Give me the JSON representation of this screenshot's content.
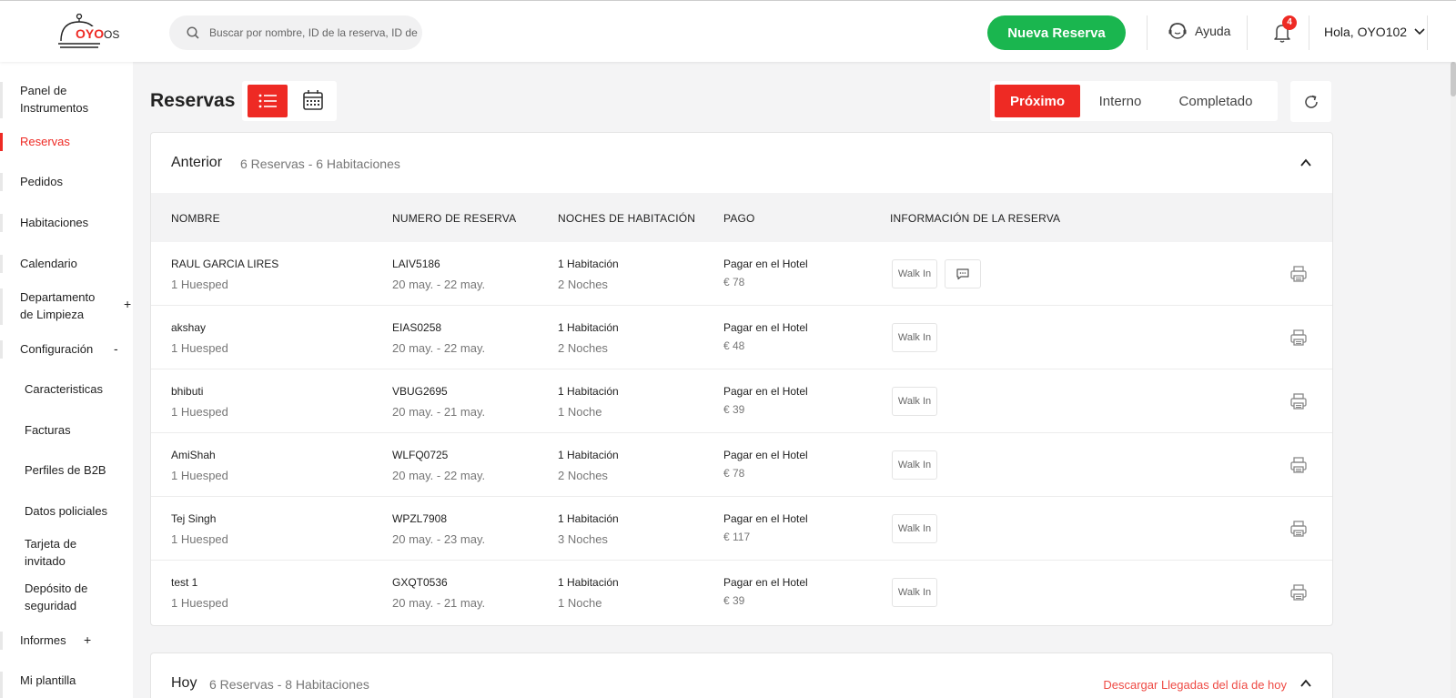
{
  "brand": {
    "logo_text": "OYO",
    "logo_suffix": "OS",
    "accent": "#ee2a24",
    "green": "#1ab64f"
  },
  "search": {
    "placeholder": "Buscar por nombre, ID de la reserva, ID de"
  },
  "topbar": {
    "new_booking": "Nueva Reserva",
    "help": "Ayuda",
    "notifications_count": "4",
    "greeting": "Hola, OYO102"
  },
  "sidebar": {
    "items": [
      {
        "label": "Panel de Instrumentos"
      },
      {
        "label": "Reservas",
        "active": true
      },
      {
        "label": "Pedidos"
      },
      {
        "label": "Habitaciones"
      },
      {
        "label": "Calendario"
      },
      {
        "label": "Departamento de Limpieza",
        "toggle": "+"
      },
      {
        "label": "Configuración",
        "toggle": "-"
      },
      {
        "label": "Caracteristicas"
      },
      {
        "label": "Facturas"
      },
      {
        "label": "Perfiles de B2B"
      },
      {
        "label": "Datos policiales"
      },
      {
        "label": "Tarjeta de invitado"
      },
      {
        "label": "Depósito de seguridad"
      },
      {
        "label": "Informes",
        "toggle": "+"
      },
      {
        "label": "Mi plantilla"
      }
    ]
  },
  "main": {
    "title": "Reservas",
    "filters": [
      "Próximo",
      "Interno",
      "Completado"
    ],
    "columns": [
      "NOMBRE",
      "NUMERO DE RESERVA",
      "NOCHES DE HABITACIÓN",
      "PAGO",
      "INFORMACIÓN DE LA RESERVA"
    ],
    "sections": [
      {
        "title": "Anterior",
        "summary": "6 Reservas - 6 Habitaciones",
        "rows": [
          {
            "name": "RAUL GARCIA LIRES",
            "guests": "1 Huesped",
            "id": "LAIV5186",
            "dates": "20 may. - 22 may.",
            "rooms": "1 Habitación",
            "nights": "2 Noches",
            "payment": "Pagar en el Hotel",
            "amount": "€ 78",
            "tag": "Walk In",
            "has_message": true
          },
          {
            "name": "akshay",
            "guests": "1 Huesped",
            "id": "EIAS0258",
            "dates": "20 may. - 22 may.",
            "rooms": "1 Habitación",
            "nights": "2 Noches",
            "payment": "Pagar en el Hotel",
            "amount": "€ 48",
            "tag": "Walk In"
          },
          {
            "name": "bhibuti",
            "guests": "1 Huesped",
            "id": "VBUG2695",
            "dates": "20 may. - 21 may.",
            "rooms": "1 Habitación",
            "nights": "1 Noche",
            "payment": "Pagar en el Hotel",
            "amount": "€ 39",
            "tag": "Walk In"
          },
          {
            "name": "AmiShah",
            "guests": "1 Huesped",
            "id": "WLFQ0725",
            "dates": "20 may. - 22 may.",
            "rooms": "1 Habitación",
            "nights": "2 Noches",
            "payment": "Pagar en el Hotel",
            "amount": "€ 78",
            "tag": "Walk In"
          },
          {
            "name": "Tej Singh",
            "guests": "1 Huesped",
            "id": "WPZL7908",
            "dates": "20 may. - 23 may.",
            "rooms": "1 Habitación",
            "nights": "3 Noches",
            "payment": "Pagar en el Hotel",
            "amount": "€ 117",
            "tag": "Walk In"
          },
          {
            "name": "test 1",
            "guests": "1 Huesped",
            "id": "GXQT0536",
            "dates": "20 may. - 21 may.",
            "rooms": "1 Habitación",
            "nights": "1 Noche",
            "payment": "Pagar en el Hotel",
            "amount": "€ 39",
            "tag": "Walk In"
          }
        ]
      },
      {
        "title": "Hoy",
        "summary": "6 Reservas - 8 Habitaciones",
        "download_link": "Descargar Llegadas del día de hoy"
      }
    ]
  }
}
